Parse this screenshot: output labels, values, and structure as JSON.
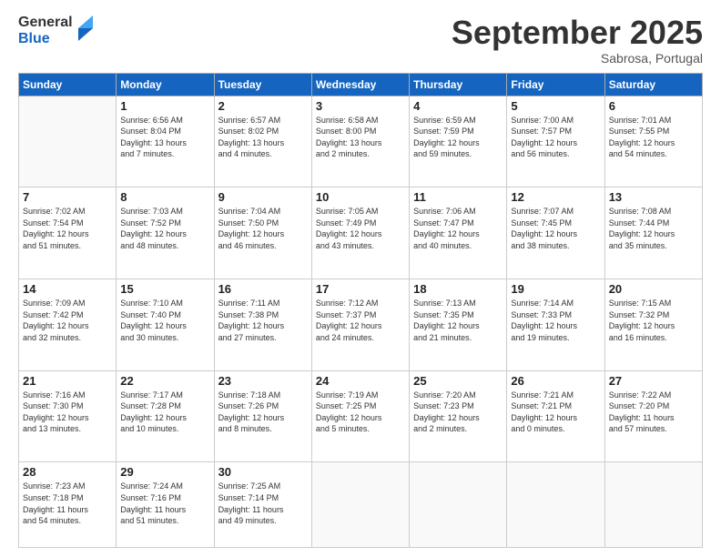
{
  "header": {
    "logo_general": "General",
    "logo_blue": "Blue",
    "month_title": "September 2025",
    "location": "Sabrosa, Portugal"
  },
  "weekdays": [
    "Sunday",
    "Monday",
    "Tuesday",
    "Wednesday",
    "Thursday",
    "Friday",
    "Saturday"
  ],
  "weeks": [
    [
      {
        "day": "",
        "info": ""
      },
      {
        "day": "1",
        "info": "Sunrise: 6:56 AM\nSunset: 8:04 PM\nDaylight: 13 hours\nand 7 minutes."
      },
      {
        "day": "2",
        "info": "Sunrise: 6:57 AM\nSunset: 8:02 PM\nDaylight: 13 hours\nand 4 minutes."
      },
      {
        "day": "3",
        "info": "Sunrise: 6:58 AM\nSunset: 8:00 PM\nDaylight: 13 hours\nand 2 minutes."
      },
      {
        "day": "4",
        "info": "Sunrise: 6:59 AM\nSunset: 7:59 PM\nDaylight: 12 hours\nand 59 minutes."
      },
      {
        "day": "5",
        "info": "Sunrise: 7:00 AM\nSunset: 7:57 PM\nDaylight: 12 hours\nand 56 minutes."
      },
      {
        "day": "6",
        "info": "Sunrise: 7:01 AM\nSunset: 7:55 PM\nDaylight: 12 hours\nand 54 minutes."
      }
    ],
    [
      {
        "day": "7",
        "info": "Sunrise: 7:02 AM\nSunset: 7:54 PM\nDaylight: 12 hours\nand 51 minutes."
      },
      {
        "day": "8",
        "info": "Sunrise: 7:03 AM\nSunset: 7:52 PM\nDaylight: 12 hours\nand 48 minutes."
      },
      {
        "day": "9",
        "info": "Sunrise: 7:04 AM\nSunset: 7:50 PM\nDaylight: 12 hours\nand 46 minutes."
      },
      {
        "day": "10",
        "info": "Sunrise: 7:05 AM\nSunset: 7:49 PM\nDaylight: 12 hours\nand 43 minutes."
      },
      {
        "day": "11",
        "info": "Sunrise: 7:06 AM\nSunset: 7:47 PM\nDaylight: 12 hours\nand 40 minutes."
      },
      {
        "day": "12",
        "info": "Sunrise: 7:07 AM\nSunset: 7:45 PM\nDaylight: 12 hours\nand 38 minutes."
      },
      {
        "day": "13",
        "info": "Sunrise: 7:08 AM\nSunset: 7:44 PM\nDaylight: 12 hours\nand 35 minutes."
      }
    ],
    [
      {
        "day": "14",
        "info": "Sunrise: 7:09 AM\nSunset: 7:42 PM\nDaylight: 12 hours\nand 32 minutes."
      },
      {
        "day": "15",
        "info": "Sunrise: 7:10 AM\nSunset: 7:40 PM\nDaylight: 12 hours\nand 30 minutes."
      },
      {
        "day": "16",
        "info": "Sunrise: 7:11 AM\nSunset: 7:38 PM\nDaylight: 12 hours\nand 27 minutes."
      },
      {
        "day": "17",
        "info": "Sunrise: 7:12 AM\nSunset: 7:37 PM\nDaylight: 12 hours\nand 24 minutes."
      },
      {
        "day": "18",
        "info": "Sunrise: 7:13 AM\nSunset: 7:35 PM\nDaylight: 12 hours\nand 21 minutes."
      },
      {
        "day": "19",
        "info": "Sunrise: 7:14 AM\nSunset: 7:33 PM\nDaylight: 12 hours\nand 19 minutes."
      },
      {
        "day": "20",
        "info": "Sunrise: 7:15 AM\nSunset: 7:32 PM\nDaylight: 12 hours\nand 16 minutes."
      }
    ],
    [
      {
        "day": "21",
        "info": "Sunrise: 7:16 AM\nSunset: 7:30 PM\nDaylight: 12 hours\nand 13 minutes."
      },
      {
        "day": "22",
        "info": "Sunrise: 7:17 AM\nSunset: 7:28 PM\nDaylight: 12 hours\nand 10 minutes."
      },
      {
        "day": "23",
        "info": "Sunrise: 7:18 AM\nSunset: 7:26 PM\nDaylight: 12 hours\nand 8 minutes."
      },
      {
        "day": "24",
        "info": "Sunrise: 7:19 AM\nSunset: 7:25 PM\nDaylight: 12 hours\nand 5 minutes."
      },
      {
        "day": "25",
        "info": "Sunrise: 7:20 AM\nSunset: 7:23 PM\nDaylight: 12 hours\nand 2 minutes."
      },
      {
        "day": "26",
        "info": "Sunrise: 7:21 AM\nSunset: 7:21 PM\nDaylight: 12 hours\nand 0 minutes."
      },
      {
        "day": "27",
        "info": "Sunrise: 7:22 AM\nSunset: 7:20 PM\nDaylight: 11 hours\nand 57 minutes."
      }
    ],
    [
      {
        "day": "28",
        "info": "Sunrise: 7:23 AM\nSunset: 7:18 PM\nDaylight: 11 hours\nand 54 minutes."
      },
      {
        "day": "29",
        "info": "Sunrise: 7:24 AM\nSunset: 7:16 PM\nDaylight: 11 hours\nand 51 minutes."
      },
      {
        "day": "30",
        "info": "Sunrise: 7:25 AM\nSunset: 7:14 PM\nDaylight: 11 hours\nand 49 minutes."
      },
      {
        "day": "",
        "info": ""
      },
      {
        "day": "",
        "info": ""
      },
      {
        "day": "",
        "info": ""
      },
      {
        "day": "",
        "info": ""
      }
    ]
  ]
}
